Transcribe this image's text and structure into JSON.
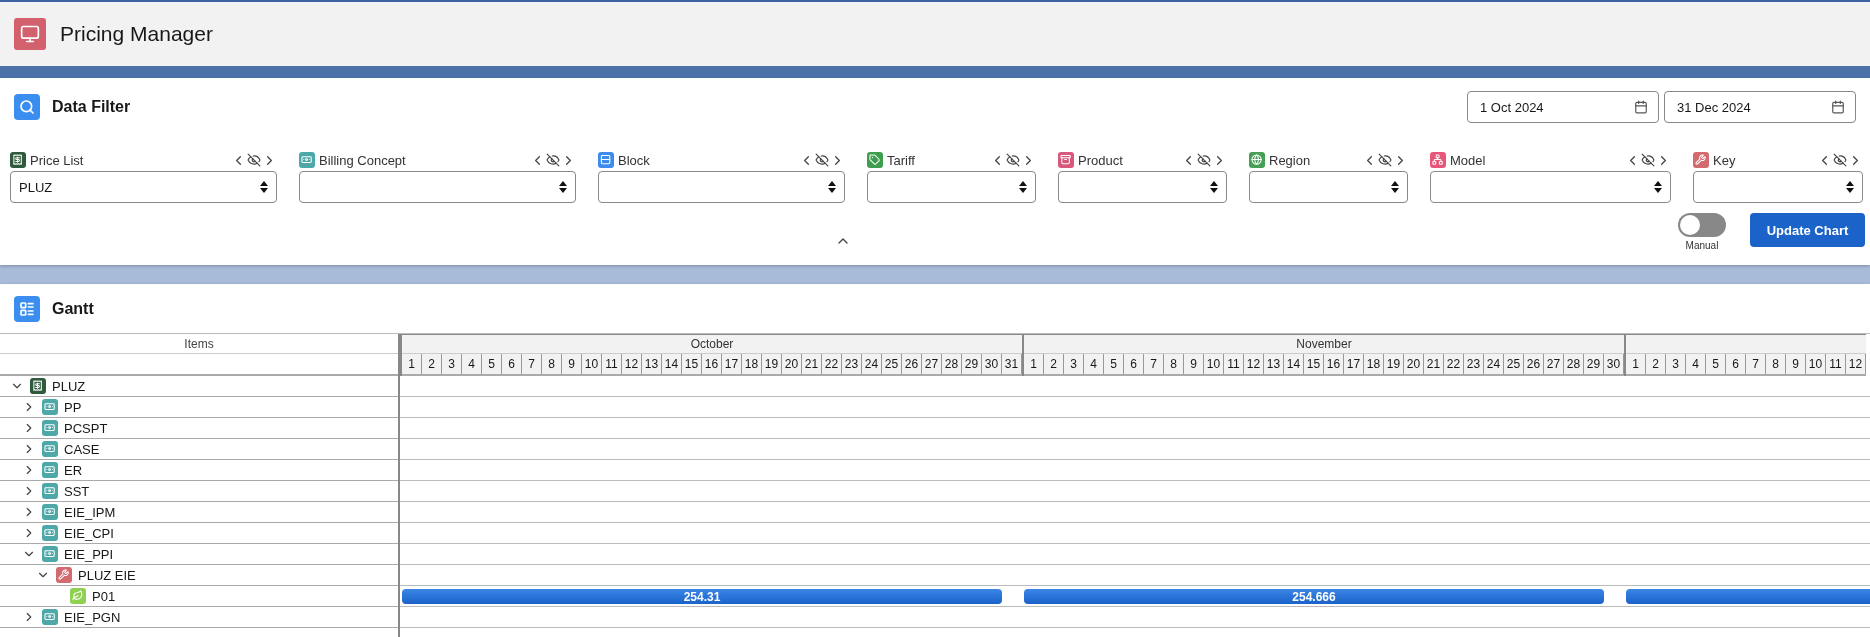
{
  "header": {
    "title": "Pricing Manager"
  },
  "filter_panel": {
    "title": "Data Filter",
    "date_from": "1 Oct 2024",
    "date_to": "31 Dec 2024",
    "filters": [
      {
        "kind": "price_list",
        "label": "Price List",
        "value": "PLUZ"
      },
      {
        "kind": "billing_concept",
        "label": "Billing Concept"
      },
      {
        "kind": "block",
        "label": "Block"
      },
      {
        "kind": "tariff",
        "label": "Tariff"
      },
      {
        "kind": "product",
        "label": "Product"
      },
      {
        "kind": "region",
        "label": "Region"
      },
      {
        "kind": "model",
        "label": "Model"
      },
      {
        "kind": "key",
        "label": "Key"
      }
    ],
    "toggle": {
      "label": "Manual",
      "on": false
    },
    "update_button": "Update Chart"
  },
  "gantt": {
    "title": "Gantt",
    "items_header": "Items",
    "months": [
      {
        "name": "October",
        "days": [
          "1",
          "2",
          "3",
          "4",
          "5",
          "6",
          "7",
          "8",
          "9",
          "10",
          "11",
          "12",
          "13",
          "14",
          "15",
          "16",
          "17",
          "18",
          "19",
          "20",
          "21",
          "22",
          "23",
          "24",
          "25",
          "26",
          "27",
          "28",
          "29",
          "30",
          "31"
        ]
      },
      {
        "name": "November",
        "days": [
          "1",
          "2",
          "3",
          "4",
          "5",
          "6",
          "7",
          "8",
          "9",
          "10",
          "11",
          "12",
          "13",
          "14",
          "15",
          "16",
          "17",
          "18",
          "19",
          "20",
          "21",
          "22",
          "23",
          "24",
          "25",
          "26",
          "27",
          "28",
          "29",
          "30"
        ]
      },
      {
        "days": [
          "1",
          "2",
          "3",
          "4",
          "5",
          "6",
          "7",
          "8",
          "9",
          "10",
          "11",
          "12"
        ]
      }
    ],
    "tree": [
      {
        "kind": "price_list",
        "label": "PLUZ",
        "expanded": true,
        "children": [
          {
            "kind": "billing_concept",
            "label": "PP",
            "expanded": false
          },
          {
            "kind": "billing_concept",
            "label": "PCSPT",
            "expanded": false
          },
          {
            "kind": "billing_concept",
            "label": "CASE",
            "expanded": false
          },
          {
            "kind": "billing_concept",
            "label": "ER",
            "expanded": false
          },
          {
            "kind": "billing_concept",
            "label": "SST",
            "expanded": false
          },
          {
            "kind": "billing_concept",
            "label": "EIE_IPM",
            "expanded": false
          },
          {
            "kind": "billing_concept",
            "label": "EIE_CPI",
            "expanded": false
          },
          {
            "kind": "billing_concept",
            "label": "EIE_PPI",
            "expanded": true,
            "children": [
              {
                "kind": "key",
                "label": "PLUZ EIE",
                "expanded": true,
                "children": [
                  {
                    "kind": "leaf",
                    "label": "P01",
                    "bars": [
                      {
                        "kind": "bar",
                        "label": "254.31"
                      },
                      {
                        "kind": "bar",
                        "label": "254.666"
                      },
                      {
                        "kind": "bar"
                      }
                    ]
                  }
                ]
              }
            ]
          },
          {
            "kind": "billing_concept",
            "label": "EIE_PGN",
            "expanded": false
          }
        ]
      }
    ]
  }
}
